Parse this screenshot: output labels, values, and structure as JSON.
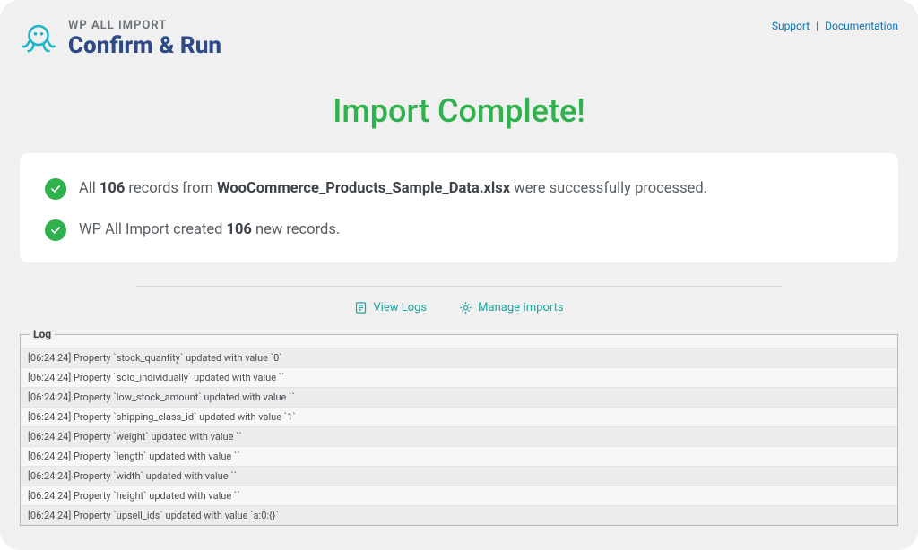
{
  "brand": {
    "small": "WP ALL IMPORT",
    "big": "Confirm & Run"
  },
  "top_links": {
    "support": "Support",
    "documentation": "Documentation"
  },
  "headline": "Import Complete!",
  "summary": {
    "records": "106",
    "filename": "WooCommerce_Products_Sample_Data.xlsx",
    "line1_prefix": "All ",
    "line1_mid": " records from ",
    "line1_suffix": " were successfully processed.",
    "line2_prefix": "WP All Import created ",
    "line2_suffix": " new records."
  },
  "actions": {
    "view_logs": "View Logs",
    "manage_imports": "Manage Imports"
  },
  "log": {
    "title": "Log",
    "lines": [
      "[06:24:24] Property `stock_quantity` updated with value `0`",
      "[06:24:24] Property `sold_individually` updated with value ``",
      "[06:24:24] Property `low_stock_amount` updated with value ``",
      "[06:24:24] Property `shipping_class_id` updated with value `1`",
      "[06:24:24] Property `weight` updated with value ``",
      "[06:24:24] Property `length` updated with value ``",
      "[06:24:24] Property `width` updated with value ``",
      "[06:24:24] Property `height` updated with value ``",
      "[06:24:24] Property `upsell_ids` updated with value `a:0:{}`"
    ]
  }
}
